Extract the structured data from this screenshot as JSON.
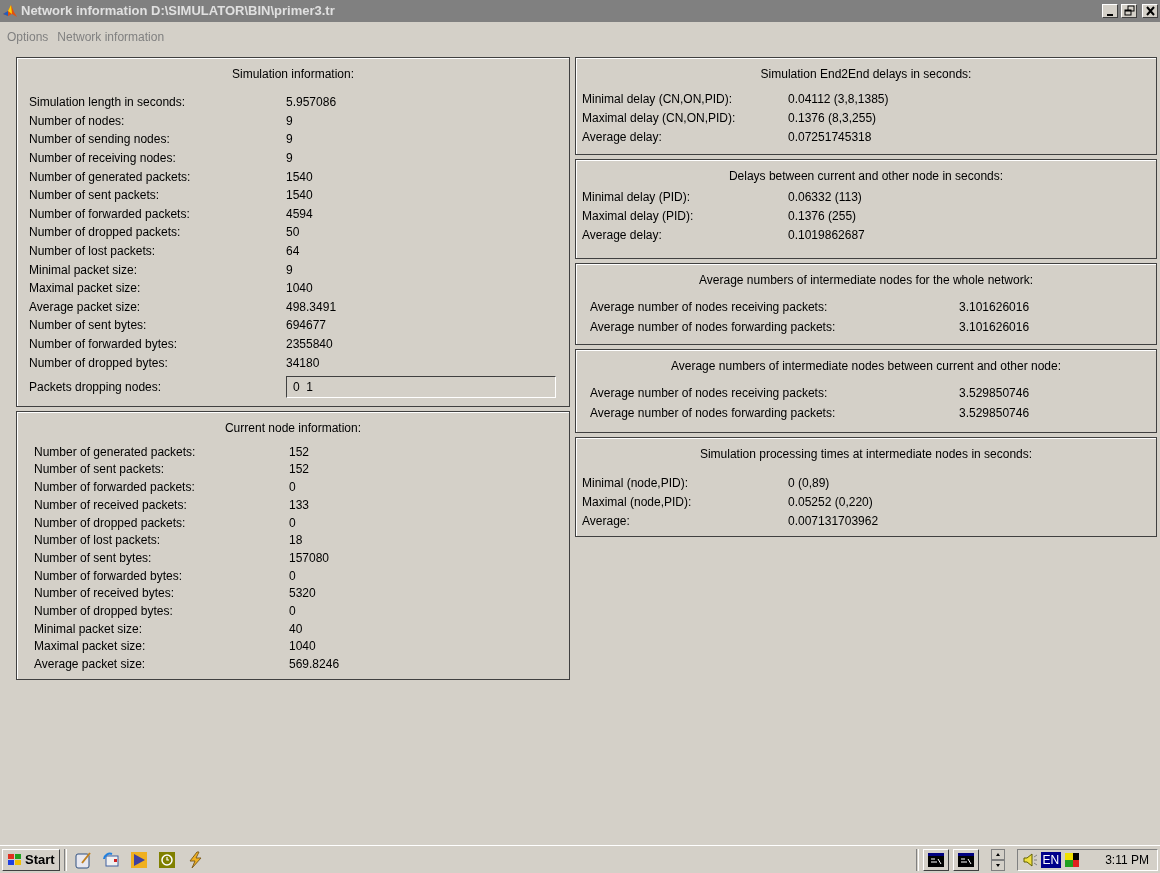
{
  "window": {
    "title": "Network information  D:\\SIMULATOR\\BIN\\primer3.tr"
  },
  "menu": [
    {
      "label": "Options",
      "disabled": true
    },
    {
      "label": "Network information",
      "disabled": true
    }
  ],
  "left_sections": [
    {
      "title": "Simulation information:",
      "rows": [
        {
          "label": "Simulation length in seconds:",
          "value": "5.957086"
        },
        {
          "label": "Number of nodes:",
          "value": "9"
        },
        {
          "label": "Number of sending nodes:",
          "value": "9"
        },
        {
          "label": "Number of receiving nodes:",
          "value": "9"
        },
        {
          "label": "Number of generated packets:",
          "value": "1540"
        },
        {
          "label": "Number of sent packets:",
          "value": "1540"
        },
        {
          "label": "Number of forwarded packets:",
          "value": "4594"
        },
        {
          "label": "Number of dropped packets:",
          "value": "50"
        },
        {
          "label": "Number of lost packets:",
          "value": "64"
        },
        {
          "label": "Minimal packet size:",
          "value": "9"
        },
        {
          "label": "Maximal packet size:",
          "value": "1040"
        },
        {
          "label": "Average packet size:",
          "value": "498.3491"
        },
        {
          "label": "Number of sent bytes:",
          "value": "694677"
        },
        {
          "label": "Number of forwarded bytes:",
          "value": "2355840"
        },
        {
          "label": "Number of dropped bytes:",
          "value": "34180"
        },
        {
          "label": "Packets dropping nodes:",
          "value": "0  1",
          "kind": "field"
        }
      ]
    },
    {
      "title": "Current node information:",
      "rows": [
        {
          "label": "Number of generated packets:",
          "value": "152"
        },
        {
          "label": "Number of sent packets:",
          "value": "152"
        },
        {
          "label": "Number of forwarded packets:",
          "value": "0"
        },
        {
          "label": "Number of received packets:",
          "value": "133"
        },
        {
          "label": "Number of dropped packets:",
          "value": "0"
        },
        {
          "label": "Number of lost packets:",
          "value": "18"
        },
        {
          "label": "Number of sent bytes:",
          "value": "157080"
        },
        {
          "label": "Number of forwarded bytes:",
          "value": "0"
        },
        {
          "label": "Number of received bytes:",
          "value": "5320"
        },
        {
          "label": "Number of dropped bytes:",
          "value": "0"
        },
        {
          "label": "Minimal packet size:",
          "value": "40"
        },
        {
          "label": "Maximal packet size:",
          "value": "1040"
        },
        {
          "label": "Average packet size:",
          "value": "569.8246"
        }
      ]
    }
  ],
  "right_sections": [
    {
      "title": "Simulation End2End delays in seconds:",
      "kind": "compact",
      "rows": [
        {
          "label": "Minimal delay (CN,ON,PID):",
          "value": "0.04112 (3,8,1385)"
        },
        {
          "label": "Maximal delay (CN,ON,PID):",
          "value": "0.1376 (8,3,255)"
        },
        {
          "label": "Average delay:",
          "value": "0.07251745318"
        }
      ]
    },
    {
      "title": "Delays between current and other node in seconds:",
      "kind": "compact",
      "rows": [
        {
          "label": "Minimal delay (PID):",
          "value": "0.06332 (113)"
        },
        {
          "label": "Maximal delay (PID):",
          "value": "0.1376 (255)"
        },
        {
          "label": "Average delay:",
          "value": "0.1019862687"
        }
      ]
    },
    {
      "title": "Average numbers of intermediate nodes for the whole network:",
      "kind": "wide",
      "rows": [
        {
          "label": "Average number of nodes receiving packets:",
          "value": "3.101626016"
        },
        {
          "label": "Average number of nodes forwarding packets:",
          "value": "3.101626016"
        }
      ]
    },
    {
      "title": "Average numbers of intermediate nodes between current and other node:",
      "kind": "wide",
      "rows": [
        {
          "label": "Average number of nodes receiving packets:",
          "value": "3.529850746"
        },
        {
          "label": "Average number of nodes forwarding packets:",
          "value": "3.529850746"
        }
      ]
    },
    {
      "title": "Simulation processing times at intermediate nodes in seconds:",
      "kind": "compact",
      "rows": [
        {
          "label": "Minimal (node,PID):",
          "value": "0 (0,89)"
        },
        {
          "label": "Maximal (node,PID):",
          "value": "0.05252 (0,220)"
        },
        {
          "label": "Average:",
          "value": "0.007131703962"
        }
      ]
    }
  ],
  "taskbar": {
    "start": "Start",
    "language": "EN",
    "clock": "3:11 PM"
  }
}
